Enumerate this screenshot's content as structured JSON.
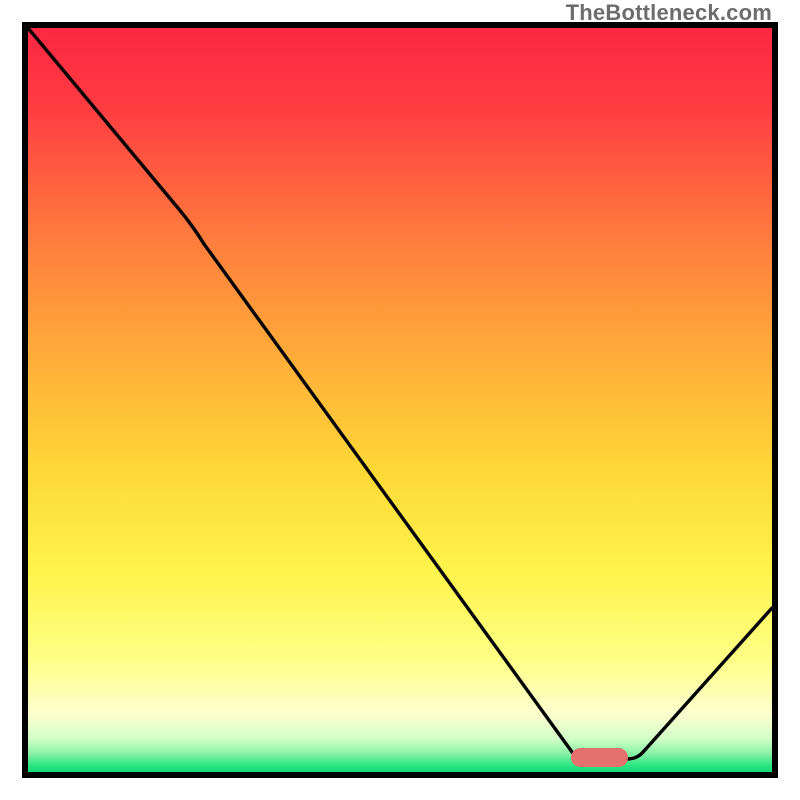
{
  "watermark": "TheBottleneck.com",
  "colors": {
    "gradient_top": "#fe2742",
    "gradient_mid_upper": "#ff8b3a",
    "gradient_mid": "#fddd38",
    "gradient_lower": "#feff74",
    "gradient_pale": "#fcffd3",
    "gradient_green": "#25e57f",
    "curve": "#000000",
    "pill": "#e5716f",
    "frame": "#000000"
  },
  "chart_data": {
    "type": "line",
    "title": "",
    "xlabel": "",
    "ylabel": "",
    "xlim": [
      0,
      100
    ],
    "ylim": [
      0,
      100
    ],
    "series": [
      {
        "name": "bottleneck-curve",
        "x": [
          0,
          20,
          73,
          80,
          100
        ],
        "y": [
          100,
          76,
          2,
          2,
          22
        ]
      }
    ],
    "marker": {
      "name": "optimal-region",
      "x_range": [
        73,
        80
      ],
      "y": 2
    },
    "annotations": []
  }
}
